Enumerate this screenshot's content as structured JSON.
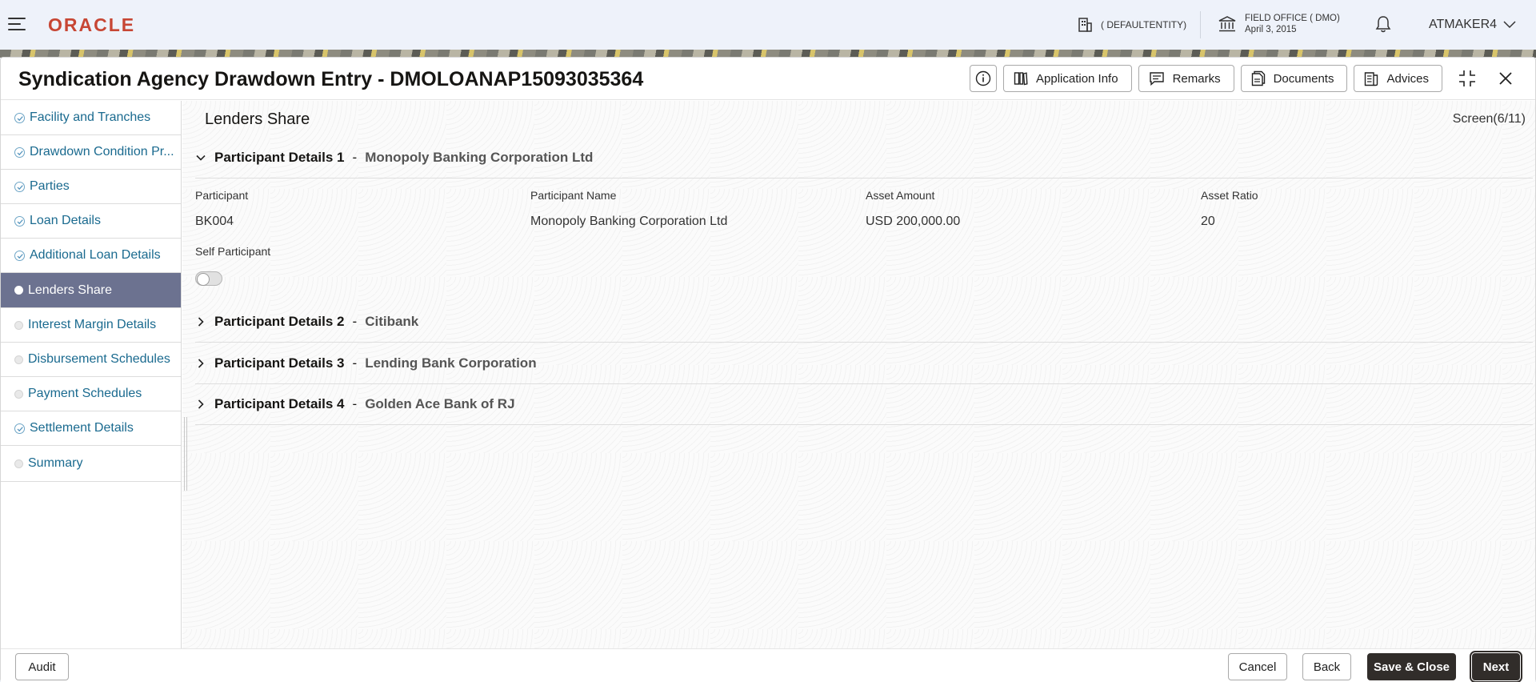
{
  "header": {
    "logo": "ORACLE",
    "entity": "( DEFAULTENTITY)",
    "office_title": "FIELD OFFICE ( DMO)",
    "office_date": "April 3, 2015",
    "user": "ATMAKER4"
  },
  "window": {
    "title": "Syndication Agency Drawdown Entry - DMOLOANAP15093035364",
    "buttons": {
      "application_info": "Application Info",
      "remarks": "Remarks",
      "documents": "Documents",
      "advices": "Advices"
    }
  },
  "sidebar": {
    "items": [
      {
        "label": "Facility and Tranches",
        "state": "done"
      },
      {
        "label": "Drawdown Condition Pr...",
        "state": "done"
      },
      {
        "label": "Parties",
        "state": "done"
      },
      {
        "label": "Loan Details",
        "state": "done"
      },
      {
        "label": "Additional Loan Details",
        "state": "done"
      },
      {
        "label": "Lenders Share",
        "state": "active"
      },
      {
        "label": "Interest Margin Details",
        "state": "pending"
      },
      {
        "label": "Disbursement Schedules",
        "state": "pending"
      },
      {
        "label": "Payment Schedules",
        "state": "pending"
      },
      {
        "label": "Settlement Details",
        "state": "done"
      },
      {
        "label": "Summary",
        "state": "pending"
      }
    ]
  },
  "main": {
    "section_title": "Lenders Share",
    "screen": "Screen(6/11)",
    "participants": [
      {
        "label": "Participant Details 1",
        "sep": "-",
        "name": "Monopoly Banking Corporation Ltd",
        "expanded": true
      },
      {
        "label": "Participant Details 2",
        "sep": "-",
        "name": "Citibank",
        "expanded": false
      },
      {
        "label": "Participant Details 3",
        "sep": "-",
        "name": "Lending Bank Corporation",
        "expanded": false
      },
      {
        "label": "Participant Details 4",
        "sep": "-",
        "name": "Golden Ace Bank of RJ",
        "expanded": false
      }
    ],
    "fields": {
      "participant_label": "Participant",
      "participant_value": "BK004",
      "participant_name_label": "Participant Name",
      "participant_name_value": "Monopoly Banking Corporation Ltd",
      "asset_amount_label": "Asset Amount",
      "asset_amount_value": "USD 200,000.00",
      "asset_ratio_label": "Asset Ratio",
      "asset_ratio_value": "20",
      "self_participant_label": "Self Participant",
      "self_participant_on": false
    }
  },
  "footer": {
    "audit": "Audit",
    "cancel": "Cancel",
    "back": "Back",
    "save_close": "Save & Close",
    "next": "Next"
  },
  "colors": {
    "brand": "#c74634",
    "link": "#1a6a8f",
    "active_nav": "#6c7290",
    "primary_button": "#312d2a"
  }
}
